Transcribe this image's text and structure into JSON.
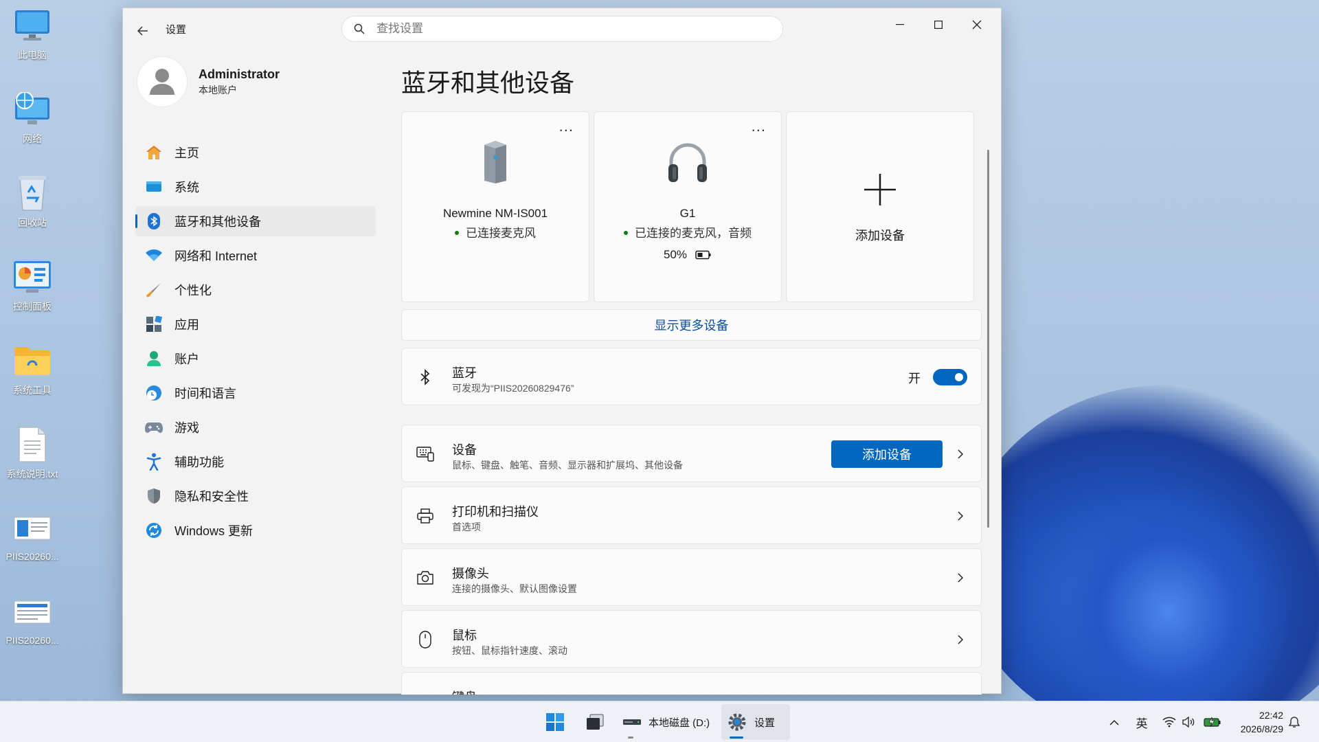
{
  "desktop": {
    "icons": [
      {
        "label": "此电脑",
        "icon": "monitor-icon"
      },
      {
        "label": "网络",
        "icon": "network-globe-icon"
      },
      {
        "label": "回收站",
        "icon": "recycle-bin-icon"
      },
      {
        "label": "控制面板",
        "icon": "control-panel-icon"
      },
      {
        "label": "系统工具",
        "icon": "folder-icon"
      },
      {
        "label": "系统说明.txt",
        "icon": "text-file-icon"
      },
      {
        "label": "PIIS20260...",
        "icon": "image-file-icon"
      },
      {
        "label": "PIIS20260...",
        "icon": "image-file-icon"
      }
    ]
  },
  "window": {
    "title": "设置",
    "search_placeholder": "查找设置"
  },
  "profile": {
    "name": "Administrator",
    "account_type": "本地账户"
  },
  "nav": {
    "items": [
      {
        "label": "主页",
        "icon": "home-icon"
      },
      {
        "label": "系统",
        "icon": "system-display-icon"
      },
      {
        "label": "蓝牙和其他设备",
        "icon": "bluetooth-icon",
        "active": true
      },
      {
        "label": "网络和 Internet",
        "icon": "wifi-icon"
      },
      {
        "label": "个性化",
        "icon": "brush-icon"
      },
      {
        "label": "应用",
        "icon": "apps-icon"
      },
      {
        "label": "账户",
        "icon": "account-icon"
      },
      {
        "label": "时间和语言",
        "icon": "time-language-icon"
      },
      {
        "label": "游戏",
        "icon": "gamepad-icon"
      },
      {
        "label": "辅助功能",
        "icon": "accessibility-icon"
      },
      {
        "label": "隐私和安全性",
        "icon": "shield-icon"
      },
      {
        "label": "Windows 更新",
        "icon": "update-icon"
      }
    ]
  },
  "page": {
    "title": "蓝牙和其他设备",
    "devices": [
      {
        "name": "Newmine NM-IS001",
        "status": "已连接麦克风",
        "icon": "speaker-device-icon",
        "more": "..."
      },
      {
        "name": "G1",
        "status": "已连接的麦克风，音频",
        "battery": "50%",
        "battery_level": 0.5,
        "icon": "headphones-icon",
        "more": "..."
      }
    ],
    "add_device_card": "添加设备",
    "show_more": "显示更多设备",
    "bluetooth": {
      "title": "蓝牙",
      "subtitle": "可发现为“PIIS20260829476”",
      "toggle_label": "开",
      "enabled": true
    },
    "rows": [
      {
        "title": "设备",
        "subtitle": "鼠标、键盘、触笔、音频、显示器和扩展坞、其他设备",
        "icon": "devices-icon",
        "button": "添加设备"
      },
      {
        "title": "打印机和扫描仪",
        "subtitle": "首选项",
        "icon": "printer-icon"
      },
      {
        "title": "摄像头",
        "subtitle": "连接的摄像头、默认图像设置",
        "icon": "camera-icon"
      },
      {
        "title": "鼠标",
        "subtitle": "按钮、鼠标指针速度、滚动",
        "icon": "mouse-icon"
      },
      {
        "title": "键盘",
        "subtitle": "",
        "icon": "keyboard-icon"
      }
    ]
  },
  "taskbar": {
    "drive_label": "本地磁盘 (D:)",
    "settings_label": "设置",
    "ime": "英",
    "time": "22:42",
    "date": "2026/8/29"
  },
  "colors": {
    "accent": "#0067c0",
    "link": "#0a4ea3",
    "connected_dot": "#107c10"
  }
}
